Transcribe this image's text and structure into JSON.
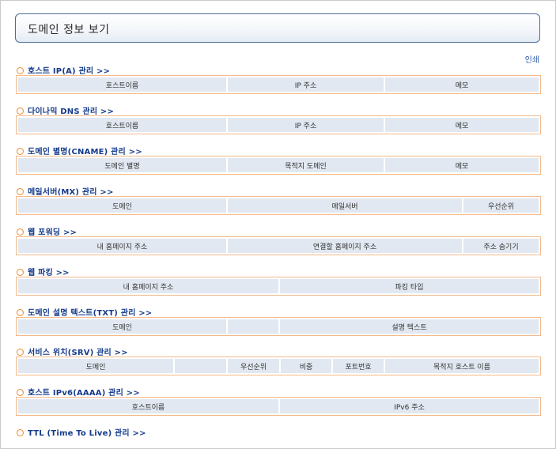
{
  "page_title": "도메인 정보 보기",
  "print_label": "인쇄",
  "sections": [
    {
      "title": "호스트 IP(A) 관리 >>",
      "columns": [
        "호스트이름",
        "IP 주소",
        "메모"
      ]
    },
    {
      "title": "다이나믹 DNS 관리 >>",
      "columns": [
        "호스트이름",
        "IP 주소",
        "메모"
      ]
    },
    {
      "title": "도메인 별명(CNAME) 관리 >>",
      "columns": [
        "도메인 별명",
        "목적지 도메인",
        "메모"
      ]
    },
    {
      "title": "메일서버(MX) 관리 >>",
      "columns": [
        "도메인",
        "메일서버",
        "우선순위"
      ]
    },
    {
      "title": "웹 포워딩 >>",
      "columns": [
        "내 홈페이지 주소",
        "연결할 홈페이지 주소",
        "주소 숨기기"
      ]
    },
    {
      "title": "웹 파킹 >>",
      "columns": [
        "내 홈페이지 주소",
        "파킹 타입"
      ]
    },
    {
      "title": "도메인 설명 텍스트(TXT) 관리 >>",
      "columns": [
        "도메인",
        "",
        "설명 텍스트"
      ]
    },
    {
      "title": "서비스 위치(SRV) 관리 >>",
      "columns": [
        "도메인",
        "",
        "우선순위",
        "비중",
        "포트번호",
        "목적지 호스트 이름"
      ]
    },
    {
      "title": "호스트 IPv6(AAAA) 관리 >>",
      "columns": [
        "호스트이름",
        "IPv6 주소"
      ]
    },
    {
      "title": "TTL (Time To Live) 관리 >>",
      "columns": []
    }
  ]
}
